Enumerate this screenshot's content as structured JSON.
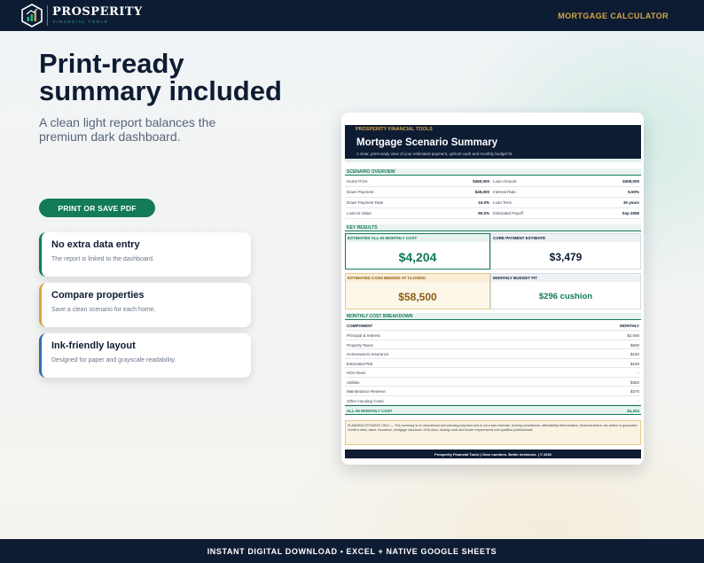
{
  "header": {
    "brand": "PROSPERITY",
    "brand_sub": "FINANCIAL TOOLS",
    "nav_label": "MORTGAGE CALCULATOR"
  },
  "hero": {
    "headline_line1": "Print-ready",
    "headline_line2": "summary included",
    "subhead": "A clean light report balances the premium dark dashboard.",
    "button_label": "PRINT OR SAVE PDF"
  },
  "features": [
    {
      "title": "No extra data entry",
      "desc": "The report is linked to the dashboard.",
      "accent": "#137a5a"
    },
    {
      "title": "Compare properties",
      "desc": "Save a clean scenario for each home.",
      "accent": "#d6a645"
    },
    {
      "title": "Ink-friendly layout",
      "desc": "Designed for paper and grayscale readability.",
      "accent": "#2f6fb3"
    }
  ],
  "report": {
    "brand": "PROSPERITY FINANCIAL TOOLS",
    "title": "Mortgage Scenario Summary",
    "desc": "A clear, print-ready view of your estimated payment, upfront cash and monthly budget fit.",
    "overview_title": "SCENARIO OVERVIEW",
    "overview": [
      {
        "l1": "Home Price",
        "v1": "$450,000",
        "l2": "Loan Amount",
        "v2": "$405,000"
      },
      {
        "l1": "Down Payment",
        "v1": "$45,000",
        "l2": "Interest Rate",
        "v2": "6.50%"
      },
      {
        "l1": "Down Payment Rate",
        "v1": "10.0%",
        "l2": "Loan Term",
        "v2": "30 years"
      },
      {
        "l1": "Loan-to-Value",
        "v1": "90.0%",
        "l2": "Estimated Payoff",
        "v2": "Sep 2056"
      }
    ],
    "key_title": "KEY RESULTS",
    "key": [
      {
        "label": "ESTIMATED ALL-IN MONTHLY COST",
        "value": "$4,204"
      },
      {
        "label": "CORE PAYMENT ESTIMATE",
        "value": "$3,479"
      },
      {
        "label": "ESTIMATED CASH NEEDED AT CLOSING",
        "value": "$58,500"
      },
      {
        "label": "MONTHLY BUDGET FIT",
        "value": "$296 cushion"
      }
    ],
    "breakdown_title": "MONTHLY COST BREAKDOWN",
    "breakdown_head": {
      "component": "COMPONENT",
      "monthly": "MONTHLY"
    },
    "breakdown": [
      {
        "name": "Principal & Interest",
        "value": "$2,560"
      },
      {
        "name": "Property Taxes",
        "value": "$600"
      },
      {
        "name": "Homeowners Insurance",
        "value": "$150"
      },
      {
        "name": "Estimated PMI",
        "value": "$169"
      },
      {
        "name": "HOA Dues",
        "value": "-"
      },
      {
        "name": "Utilities",
        "value": "$350"
      },
      {
        "name": "Maintenance Reserve",
        "value": "$375"
      },
      {
        "name": "Other Housing Costs",
        "value": "-"
      }
    ],
    "total": {
      "name": "ALL-IN MONTHLY COST",
      "value": "$4,204"
    },
    "note": "PLANNING ESTIMATE ONLY — This summary is for educational and planning purposes and is not a loan estimate, lending commitment, affordability determination, financial advice, tax advice or guarantee. Confirm rates, taxes, insurance, mortgage insurance, HOA dues, closing costs and lender requirements with qualified professionals.",
    "footer": "Prosperity Financial Tools  |  Clear numbers. Better decisions.  |  © 2026"
  },
  "footer": {
    "text": "INSTANT DIGITAL DOWNLOAD • EXCEL + NATIVE GOOGLE SHEETS"
  },
  "colors": {
    "navy": "#0e1c33",
    "green": "#137a5a",
    "gold": "#d6a645",
    "blue": "#2f6fb3"
  }
}
